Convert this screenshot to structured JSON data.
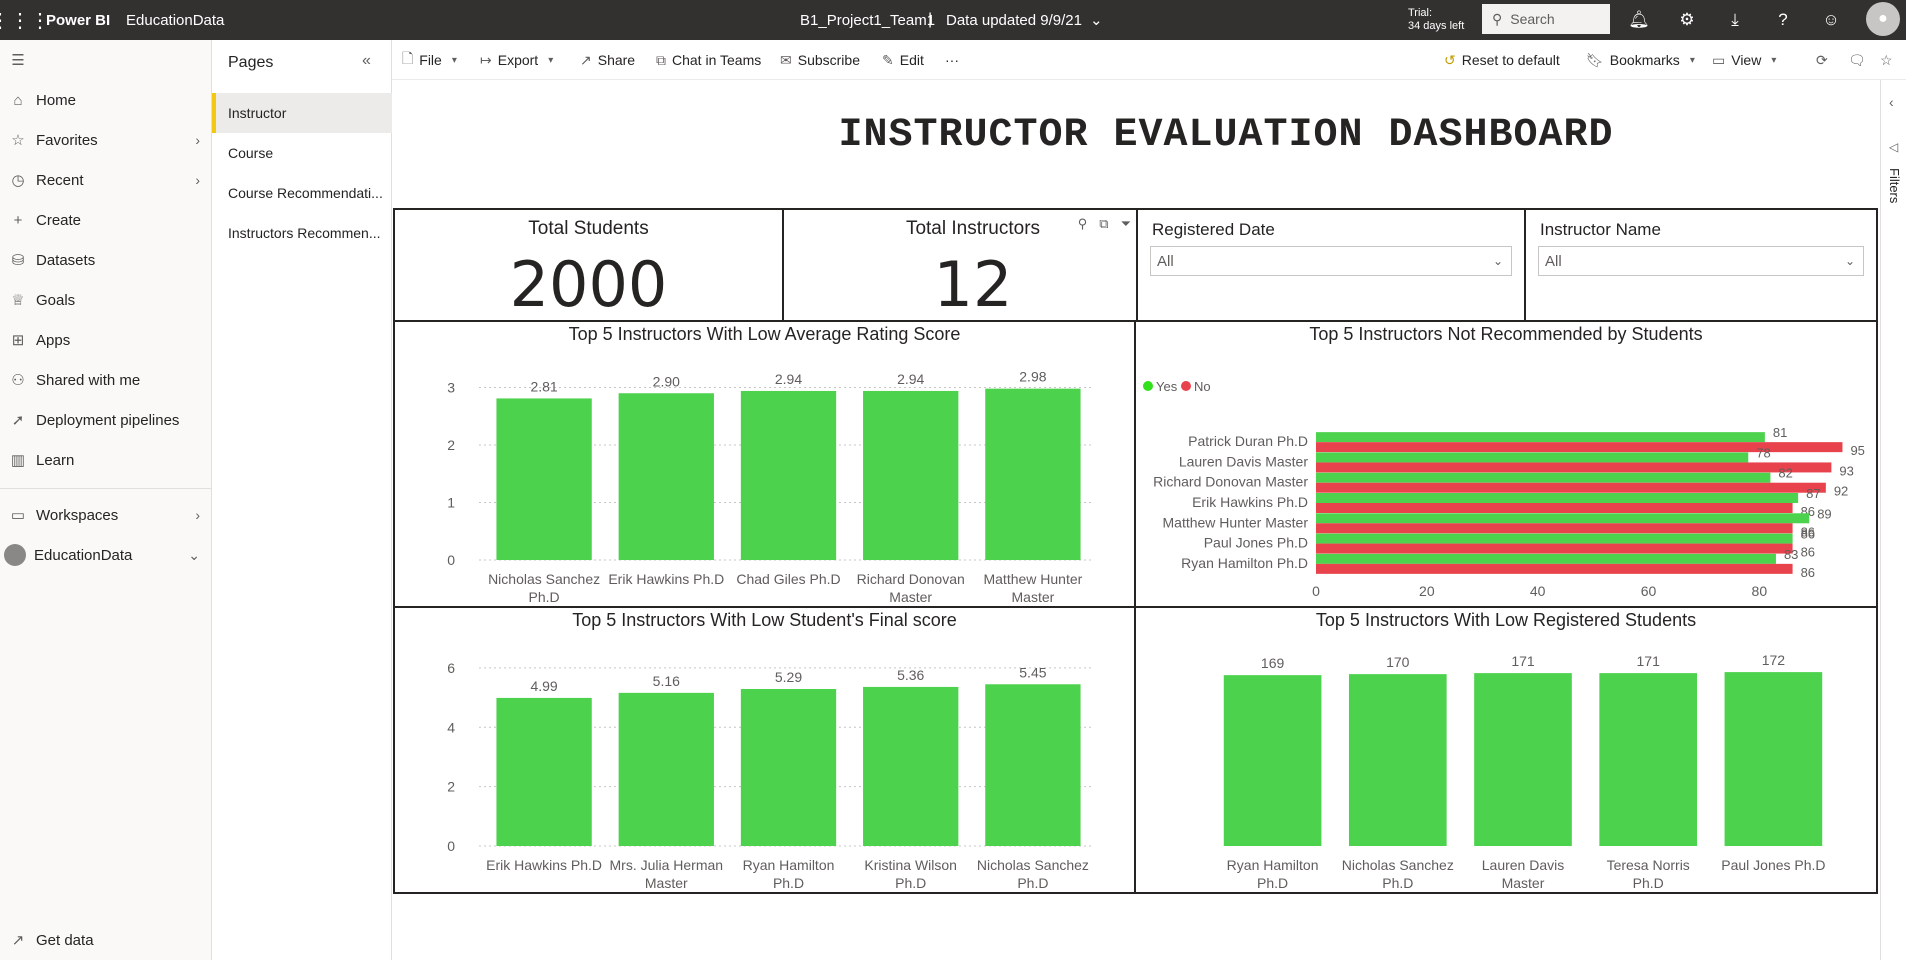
{
  "app": {
    "brand": "Power BI",
    "workspace": "EducationData",
    "report_name": "B1_Project1_Team1",
    "separator": "|",
    "data_updated": "Data updated 9/9/21",
    "trial_line1": "Trial:",
    "trial_line2": "34 days left",
    "search_placeholder": "Search"
  },
  "nav": {
    "items": [
      {
        "label": "Home"
      },
      {
        "label": "Favorites"
      },
      {
        "label": "Recent"
      },
      {
        "label": "Create"
      },
      {
        "label": "Datasets"
      },
      {
        "label": "Goals"
      },
      {
        "label": "Apps"
      },
      {
        "label": "Shared with me"
      },
      {
        "label": "Deployment pipelines"
      },
      {
        "label": "Learn"
      },
      {
        "label": "Workspaces"
      },
      {
        "label": "EducationData"
      }
    ],
    "get_data": "Get data"
  },
  "pages": {
    "title": "Pages",
    "items": [
      {
        "label": "Instructor"
      },
      {
        "label": "Course"
      },
      {
        "label": "Course Recommendati..."
      },
      {
        "label": "Instructors Recommen..."
      }
    ]
  },
  "toolbar": {
    "file": "File",
    "export": "Export",
    "share": "Share",
    "chat": "Chat in Teams",
    "subscribe": "Subscribe",
    "edit": "Edit",
    "more": "···",
    "reset": "Reset to default",
    "bookmarks": "Bookmarks",
    "view": "View"
  },
  "filters_label": "Filters",
  "dashboard": {
    "title": "INSTRUCTOR EVALUATION DASHBOARD",
    "kpis": [
      {
        "label": "Total Students",
        "value": "2000"
      },
      {
        "label": "Total Instructors",
        "value": "12"
      }
    ],
    "slicers": [
      {
        "label": "Registered Date",
        "value": "All"
      },
      {
        "label": "Instructor Name",
        "value": "All"
      }
    ]
  },
  "colors": {
    "green": "#4cd24c",
    "red": "#e8434d",
    "yes_dot": "#33e01c",
    "no_dot": "#e8434d"
  },
  "chart_data": [
    {
      "type": "bar",
      "title": "Top 5 Instructors With Low Average Rating Score",
      "categories": [
        "Nicholas Sanchez Ph.D",
        "Erik Hawkins Ph.D",
        "Chad Giles Ph.D",
        "Richard Donovan Master",
        "Matthew Hunter Master"
      ],
      "values": [
        2.81,
        2.9,
        2.94,
        2.94,
        2.98
      ],
      "labels": [
        "2.81",
        "2.90",
        "2.94",
        "2.94",
        "2.98"
      ],
      "yticks": [
        "0",
        "1",
        "2",
        "3"
      ],
      "ylim": [
        0,
        3.2
      ]
    },
    {
      "type": "bar",
      "orientation": "horizontal",
      "title": "Top 5 Instructors Not Recommended by Students",
      "legend": [
        "Yes",
        "No"
      ],
      "categories": [
        "Patrick Duran Ph.D",
        "Lauren Davis Master",
        "Richard Donovan Master",
        "Erik Hawkins Ph.D",
        "Matthew Hunter Master",
        "Paul Jones Ph.D",
        "Ryan Hamilton Ph.D"
      ],
      "series": [
        {
          "name": "Yes",
          "values": [
            81,
            78,
            82,
            87,
            89,
            86,
            83
          ]
        },
        {
          "name": "No",
          "values": [
            95,
            93,
            92,
            86,
            86,
            86,
            86
          ]
        }
      ],
      "xticks": [
        "0",
        "20",
        "40",
        "60",
        "80"
      ],
      "xlim": [
        0,
        96
      ]
    },
    {
      "type": "bar",
      "title": "Top 5 Instructors With Low Student's Final score",
      "categories": [
        "Erik Hawkins Ph.D",
        "Mrs. Julia Herman Master",
        "Ryan Hamilton Ph.D",
        "Kristina Wilson Ph.D",
        "Nicholas Sanchez Ph.D"
      ],
      "values": [
        4.99,
        5.16,
        5.29,
        5.36,
        5.45
      ],
      "labels": [
        "4.99",
        "5.16",
        "5.29",
        "5.36",
        "5.45"
      ],
      "yticks": [
        "0",
        "2",
        "4",
        "6"
      ],
      "ylim": [
        0,
        6.2
      ]
    },
    {
      "type": "bar",
      "title": "Top 5 Instructors With Low Registered Students",
      "categories": [
        "Ryan Hamilton Ph.D",
        "Nicholas Sanchez Ph.D",
        "Lauren Davis Master",
        "Teresa Norris Ph.D",
        "Paul Jones Ph.D"
      ],
      "values": [
        169,
        170,
        171,
        171,
        172
      ],
      "labels": [
        "169",
        "170",
        "171",
        "171",
        "172"
      ],
      "ylim": [
        0,
        182
      ]
    }
  ]
}
